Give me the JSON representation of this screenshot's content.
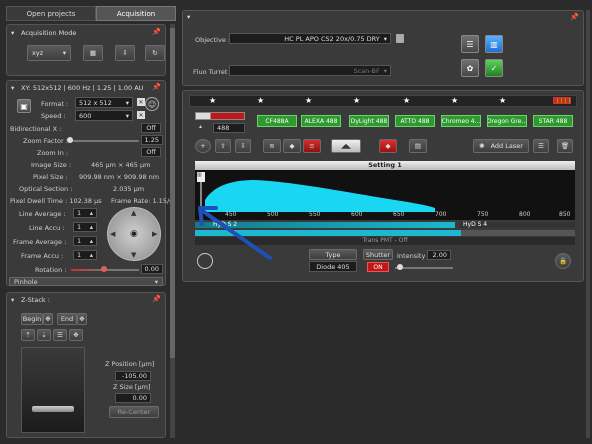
{
  "tabs": {
    "open_projects": "Open projects",
    "acquisition": "Acquisition"
  },
  "acq_mode": {
    "title": "Acquisition Mode",
    "mode_value": "xyz"
  },
  "xy": {
    "title": "XY: 512x512 | 600 Hz | 1.25 | 1.00 AU",
    "format_label": "Format :",
    "format_value": "512 x 512",
    "speed_label": "Speed :",
    "speed_value": "600",
    "bidir_label": "Bidirectional X :",
    "bidir_value": "Off",
    "zoom_factor_label": "Zoom Factor :",
    "zoom_factor_value": "1.25",
    "zoom_in_label": "Zoom In :",
    "zoom_in_value": "Off",
    "image_size_label": "Image Size :",
    "image_size_value": "465 µm × 465 µm",
    "pixel_size_label": "Pixel Size :",
    "pixel_size_value": "909.98 nm × 909.98 nm",
    "optical_section_label": "Optical Section :",
    "optical_section_value": "2.035 µm",
    "pixel_dwell": "Pixel Dwell Time : 102.38 µs",
    "frame_rate": "Frame Rate: 1.15/s",
    "line_average_label": "Line Average :",
    "line_average_value": "1",
    "line_accu_label": "Line Accu :",
    "line_accu_value": "1",
    "frame_average_label": "Frame Average :",
    "frame_average_value": "1",
    "frame_accu_label": "Frame Accu :",
    "frame_accu_value": "1",
    "rotation_label": "Rotation :",
    "rotation_value": "0.00",
    "pinhole_label": "Pinhole"
  },
  "zstack": {
    "title": "Z-Stack :",
    "begin": "Begin",
    "end": "End",
    "z_position_label": "Z Position [µm]",
    "z_position_value": "-105.00",
    "z_size_label": "Z Size [µm]",
    "z_size_value": "0.00",
    "recenter": "Re-Center"
  },
  "objective": {
    "label": "Objective :",
    "value": "HC PL APO CS2   20x/0.75 DRY",
    "turret_label": "Fluo Turret :",
    "turret_value": "Scan-BF"
  },
  "laser": {
    "wavelength_value": "488",
    "fluor_buttons": [
      "CF488A",
      "ALEXA 488",
      "DyLight 488",
      "ATTO 488",
      "Chromeo 4...",
      "Oregon Gre...",
      "STAR 488"
    ]
  },
  "setting": {
    "title": "Setting 1",
    "add_laser": "Add Laser",
    "axis_ticks": [
      "450",
      "500",
      "550",
      "600",
      "650",
      "700",
      "750",
      "800",
      "850"
    ],
    "hyd_label_1": "HyD S 2",
    "hyd_label_2": "HyD S 4",
    "trans_pmt": "Trans PMT - Off"
  },
  "bottom": {
    "type_label": "Type",
    "type_value": "Diode 405",
    "shutter_label": "Shutter",
    "shutter_value": "ON",
    "intensity_label": "Intensity",
    "intensity_value": "2.00"
  },
  "colors": {
    "accent_green": "#2d9a2d",
    "curve_cyan": "#19d6f2",
    "arrow_blue": "#1f4fb8",
    "shutter_red": "#c01818"
  }
}
